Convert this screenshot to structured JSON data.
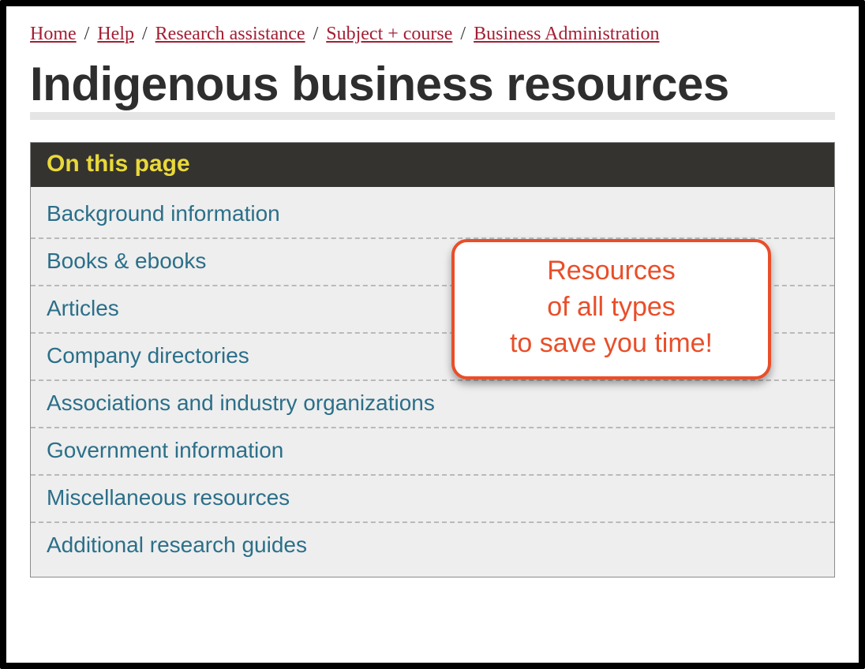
{
  "breadcrumbs": [
    {
      "label": "Home"
    },
    {
      "label": "Help"
    },
    {
      "label": "Research assistance"
    },
    {
      "label": "Subject + course"
    },
    {
      "label": "Business Administration"
    }
  ],
  "page_title": "Indigenous business resources",
  "panel": {
    "header": "On this page",
    "items": [
      "Background information",
      "Books & ebooks",
      "Articles",
      "Company directories",
      "Associations and industry organizations",
      "Government information",
      "Miscellaneous resources",
      "Additional research guides"
    ]
  },
  "callout": {
    "line1": "Resources",
    "line2": "of all types",
    "line3": "to save you time!"
  }
}
